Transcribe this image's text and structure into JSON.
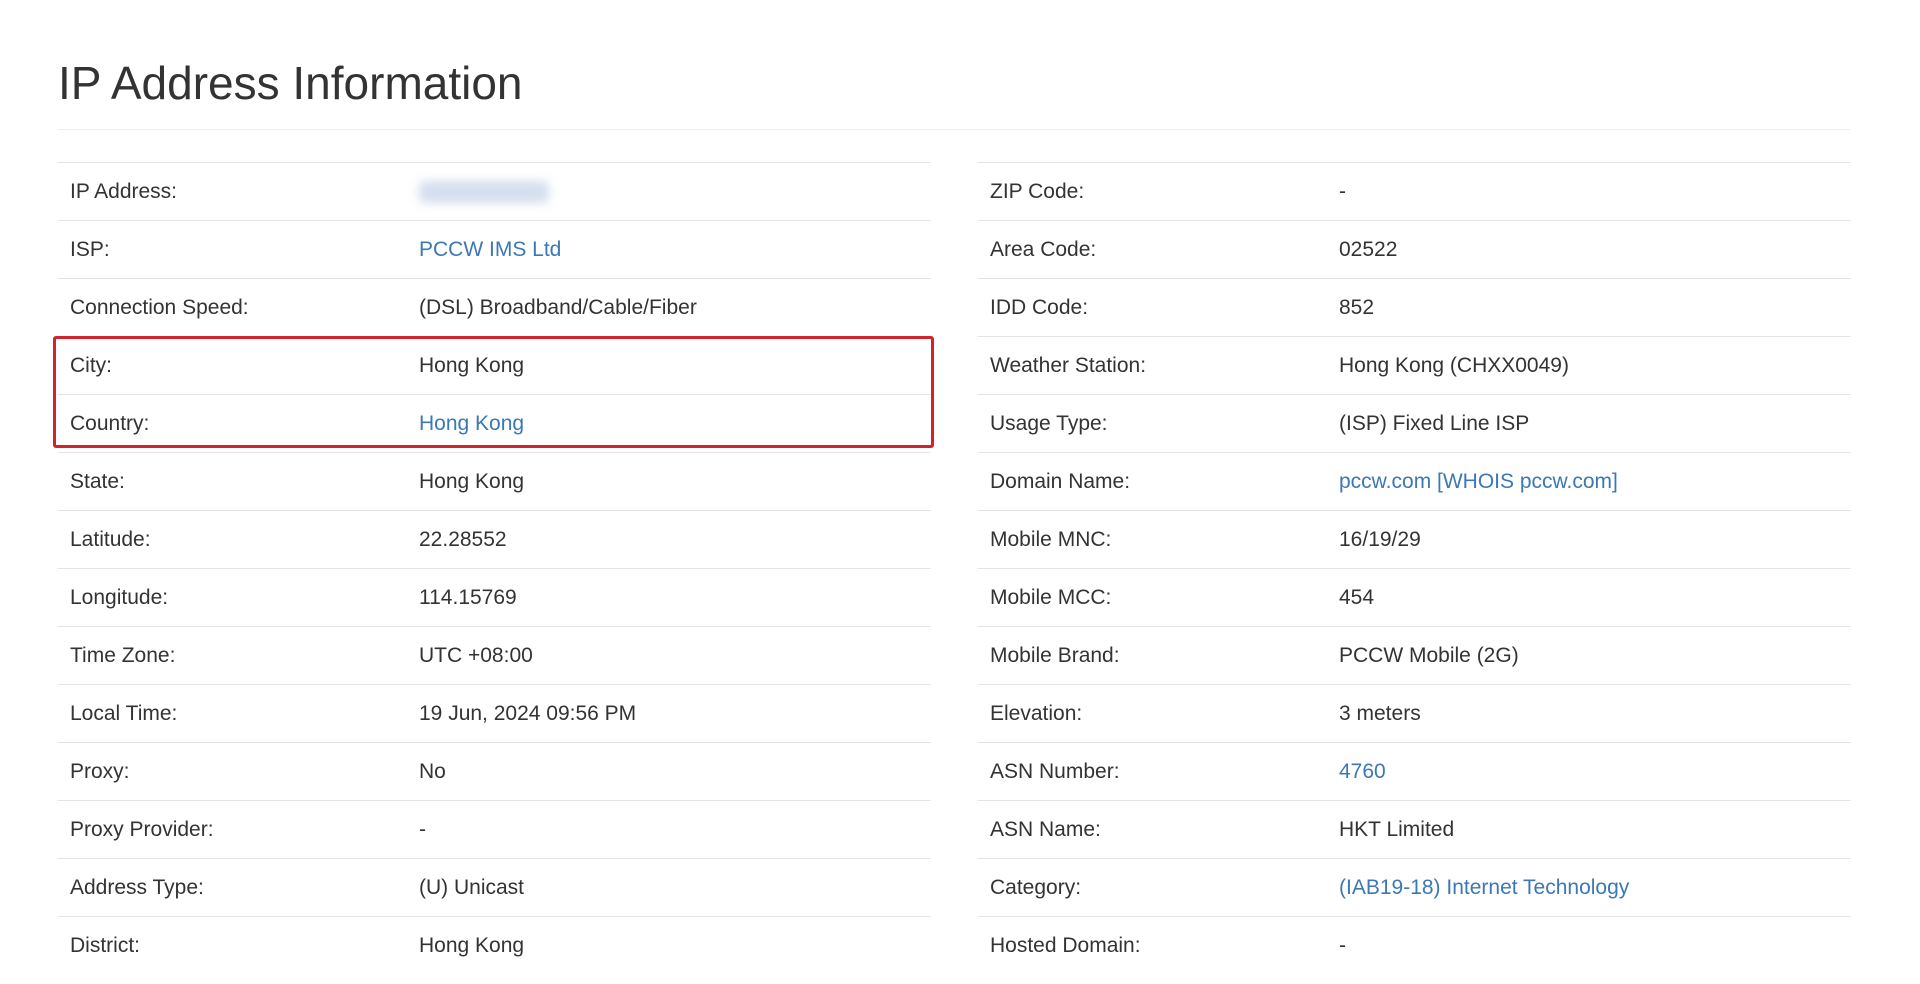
{
  "page": {
    "title": "IP Address Information"
  },
  "left_table": [
    {
      "label": "IP Address:",
      "value": ""
    },
    {
      "label": "ISP:",
      "value": "PCCW IMS Ltd"
    },
    {
      "label": "Connection Speed:",
      "value": "(DSL) Broadband/Cable/Fiber"
    },
    {
      "label": "City:",
      "value": "Hong Kong"
    },
    {
      "label": "Country:",
      "value": "Hong Kong"
    },
    {
      "label": "State:",
      "value": "Hong Kong"
    },
    {
      "label": "Latitude:",
      "value": "22.28552"
    },
    {
      "label": "Longitude:",
      "value": "114.15769"
    },
    {
      "label": "Time Zone:",
      "value": "UTC +08:00"
    },
    {
      "label": "Local Time:",
      "value": "19 Jun, 2024 09:56 PM"
    },
    {
      "label": "Proxy:",
      "value": "No"
    },
    {
      "label": "Proxy Provider:",
      "value": "-"
    },
    {
      "label": "Address Type:",
      "value": "(U) Unicast"
    },
    {
      "label": "District:",
      "value": "Hong Kong"
    }
  ],
  "right_table": [
    {
      "label": "ZIP Code:",
      "value": "-"
    },
    {
      "label": "Area Code:",
      "value": "02522"
    },
    {
      "label": "IDD Code:",
      "value": "852"
    },
    {
      "label": "Weather Station:",
      "value": "Hong Kong (CHXX0049)"
    },
    {
      "label": "Usage Type:",
      "value": "(ISP) Fixed Line ISP"
    },
    {
      "label": "Domain Name:",
      "value": "pccw.com [WHOIS pccw.com]"
    },
    {
      "label": "Mobile MNC:",
      "value": "16/19/29"
    },
    {
      "label": "Mobile MCC:",
      "value": "454"
    },
    {
      "label": "Mobile Brand:",
      "value": "PCCW Mobile (2G)"
    },
    {
      "label": "Elevation:",
      "value": "3 meters"
    },
    {
      "label": "ASN Number:",
      "value": "4760"
    },
    {
      "label": "ASN Name:",
      "value": "HKT Limited"
    },
    {
      "label": "Category:",
      "value": "(IAB19-18) Internet Technology"
    },
    {
      "label": "Hosted Domain:",
      "value": "-"
    }
  ],
  "colors": {
    "link": "#3b78b5",
    "text": "#333333",
    "highlight": "#d2232a",
    "row_border": "#e4e4e4"
  }
}
